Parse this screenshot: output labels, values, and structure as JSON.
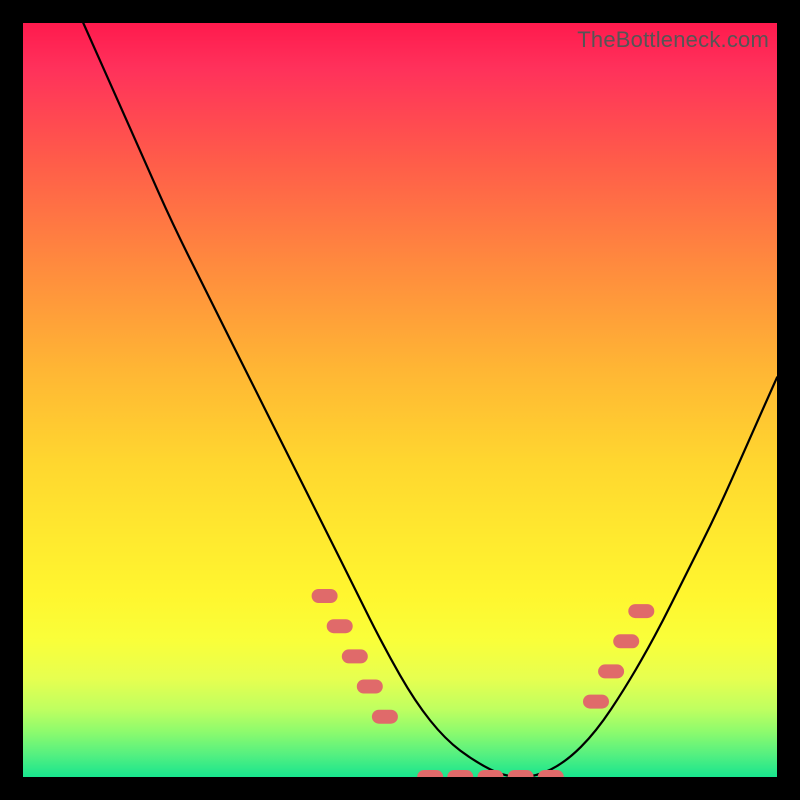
{
  "watermark": "TheBottleneck.com",
  "chart_data": {
    "type": "line",
    "title": "",
    "xlabel": "",
    "ylabel": "",
    "xlim": [
      0,
      100
    ],
    "ylim": [
      0,
      100
    ],
    "grid": false,
    "legend": false,
    "series": [
      {
        "name": "curve",
        "color": "#000000",
        "x": [
          8,
          12,
          16,
          20,
          25,
          30,
          35,
          40,
          44,
          48,
          52,
          56,
          60,
          64,
          68,
          72,
          76,
          80,
          84,
          88,
          92,
          96,
          100
        ],
        "values": [
          100,
          91,
          82,
          73,
          63,
          53,
          43,
          33,
          25,
          17,
          10,
          5,
          2,
          0,
          0,
          2,
          6,
          12,
          19,
          27,
          35,
          44,
          53
        ]
      },
      {
        "name": "dots-left",
        "type": "scatter",
        "color": "#e06a6a",
        "x": [
          40,
          42,
          44,
          46,
          48
        ],
        "values": [
          24,
          20,
          16,
          12,
          8
        ]
      },
      {
        "name": "dots-flat",
        "type": "scatter",
        "color": "#e06a6a",
        "x": [
          54,
          58,
          62,
          66,
          70
        ],
        "values": [
          0,
          0,
          0,
          0,
          0
        ]
      },
      {
        "name": "dots-right",
        "type": "scatter",
        "color": "#e06a6a",
        "x": [
          76,
          78,
          80,
          82
        ],
        "values": [
          10,
          14,
          18,
          22
        ]
      }
    ],
    "background_gradient": {
      "direction": "vertical",
      "stops": [
        {
          "pos": 0.0,
          "color": "#ff1a4d"
        },
        {
          "pos": 0.5,
          "color": "#ffd62f"
        },
        {
          "pos": 0.85,
          "color": "#e6ff50"
        },
        {
          "pos": 1.0,
          "color": "#18e58e"
        }
      ]
    }
  }
}
